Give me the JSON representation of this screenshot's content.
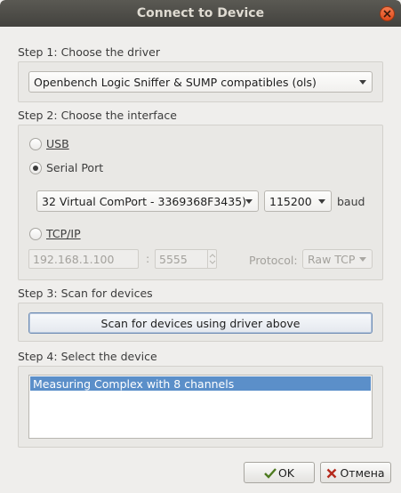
{
  "window": {
    "title": "Connect to Device"
  },
  "step1": {
    "label": "Step 1: Choose the driver",
    "driver_selected": "Openbench Logic Sniffer & SUMP compatibles (ols)"
  },
  "step2": {
    "label": "Step 2: Choose the interface",
    "usb_label": "USB",
    "serial_label": "Serial Port",
    "tcp_label": "TCP/IP",
    "selected": "serial",
    "serial_port_selected": "32 Virtual ComPort - 3369368F3435)",
    "baud_selected": "115200",
    "baud_unit": "baud",
    "tcp_host": "192.168.1.100",
    "tcp_separator": ":",
    "tcp_port": "5555",
    "protocol_label": "Protocol:",
    "protocol_selected": "Raw TCP"
  },
  "step3": {
    "label": "Step 3: Scan for devices",
    "scan_button": "Scan for devices using driver above"
  },
  "step4": {
    "label": "Step 4: Select the device",
    "devices": [
      "Measuring Complex with 8 channels"
    ]
  },
  "buttons": {
    "ok": "OK",
    "cancel": "Отмена"
  },
  "colors": {
    "selection": "#5b8fc9",
    "titlebar": "#4a4945",
    "close": "#e55b2b"
  }
}
